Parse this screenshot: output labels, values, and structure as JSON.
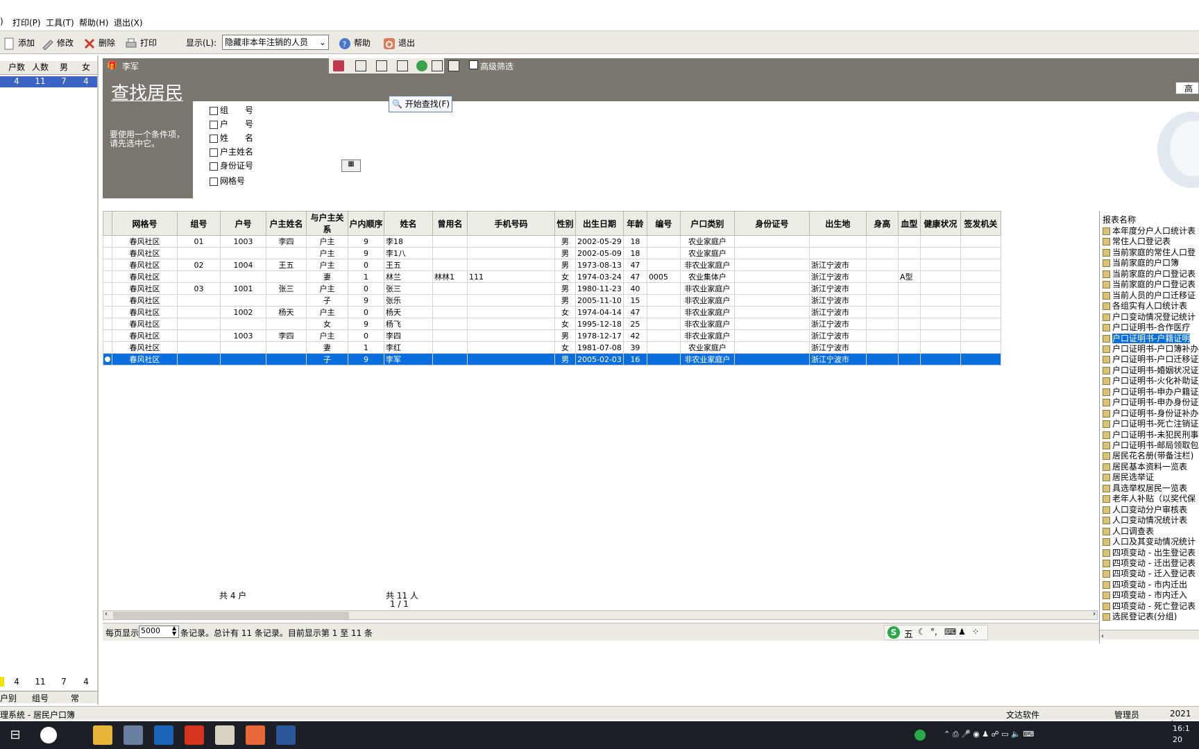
{
  "menu": {
    "items": [
      ")",
      "打印(P)",
      "工具(T)",
      "帮助(H)",
      "退出(X)"
    ]
  },
  "toolbar": {
    "add": "添加",
    "edit": "修改",
    "delete": "删除",
    "print": "打印",
    "display_label": "显示(L):",
    "display_value": "隐藏非本年注销的人员",
    "help": "帮助",
    "exit": "退出"
  },
  "left": {
    "headers": [
      "户数",
      "人数",
      "男",
      "女"
    ],
    "row": [
      "4",
      "11",
      "7",
      "4"
    ],
    "footer": [
      "4",
      "11",
      "7",
      "4"
    ],
    "tabs": [
      "户别",
      "组号",
      "常"
    ]
  },
  "subbar": {
    "name": "李军",
    "advanced_filter": "高级筛选"
  },
  "search": {
    "title": "查找居民",
    "hint": "要使用一个条件项，请先选中它。",
    "start_button": "开始查找(F)",
    "fields": [
      "组　　号",
      "户　　号",
      "姓　　名",
      "户主姓名",
      "身份证号",
      "网格号"
    ],
    "right_button": "高"
  },
  "grid": {
    "columns": [
      "网格号",
      "组号",
      "户号",
      "户主姓名",
      "与户主关系",
      "户内顺序",
      "姓名",
      "曾用名",
      "手机号码",
      "性别",
      "出生日期",
      "年龄",
      "编号",
      "户口类别",
      "身份证号",
      "出生地",
      "身高",
      "血型",
      "健康状况",
      "签发机关"
    ],
    "rows": [
      [
        "春风社区",
        "01",
        "1003",
        "李四",
        "户主",
        "9",
        "李18",
        "",
        "",
        "男",
        "2002-05-29",
        "18",
        "",
        "农业家庭户",
        "",
        "",
        "",
        "",
        "",
        ""
      ],
      [
        "春风社区",
        "",
        "",
        "",
        "户主",
        "9",
        "李1八",
        "",
        "",
        "男",
        "2002-05-09",
        "18",
        "",
        "农业家庭户",
        "",
        "",
        "",
        "",
        "",
        ""
      ],
      [
        "春风社区",
        "02",
        "1004",
        "王五",
        "户主",
        "0",
        "王五",
        "",
        "",
        "男",
        "1973-08-13",
        "47",
        "",
        "非农业家庭户",
        "",
        "浙江宁波市",
        "",
        "",
        "",
        ""
      ],
      [
        "春风社区",
        "",
        "",
        "",
        "妻",
        "1",
        "林兰",
        "林林1",
        "111",
        "女",
        "1974-03-24",
        "47",
        "0005",
        "农业集体户",
        "",
        "浙江宁波市",
        "",
        "A型",
        "",
        ""
      ],
      [
        "春风社区",
        "03",
        "1001",
        "张三",
        "户主",
        "0",
        "张三",
        "",
        "",
        "男",
        "1980-11-23",
        "40",
        "",
        "非农业家庭户",
        "",
        "浙江宁波市",
        "",
        "",
        "",
        ""
      ],
      [
        "春风社区",
        "",
        "",
        "",
        "子",
        "9",
        "张乐",
        "",
        "",
        "男",
        "2005-11-10",
        "15",
        "",
        "非农业家庭户",
        "",
        "浙江宁波市",
        "",
        "",
        "",
        ""
      ],
      [
        "春风社区",
        "",
        "1002",
        "杨天",
        "户主",
        "0",
        "杨天",
        "",
        "",
        "女",
        "1974-04-14",
        "47",
        "",
        "非农业家庭户",
        "",
        "浙江宁波市",
        "",
        "",
        "",
        ""
      ],
      [
        "春风社区",
        "",
        "",
        "",
        "女",
        "9",
        "杨飞",
        "",
        "",
        "女",
        "1995-12-18",
        "25",
        "",
        "非农业家庭户",
        "",
        "浙江宁波市",
        "",
        "",
        "",
        ""
      ],
      [
        "春风社区",
        "",
        "1003",
        "李四",
        "户主",
        "0",
        "李四",
        "",
        "",
        "男",
        "1978-12-17",
        "42",
        "",
        "非农业家庭户",
        "",
        "浙江宁波市",
        "",
        "",
        "",
        ""
      ],
      [
        "春风社区",
        "",
        "",
        "",
        "妻",
        "1",
        "李红",
        "",
        "",
        "女",
        "1981-07-08",
        "39",
        "",
        "农业家庭户",
        "",
        "浙江宁波市",
        "",
        "",
        "",
        ""
      ],
      [
        "春风社区",
        "",
        "",
        "",
        "子",
        "9",
        "李军",
        "",
        "",
        "男",
        "2005-02-03",
        "16",
        "",
        "非农业家庭户",
        "",
        "浙江宁波市",
        "",
        "",
        "",
        ""
      ]
    ],
    "selected_row": 10
  },
  "summary": {
    "households": "共 4 户",
    "persons": "共 11 人",
    "page": "1 / 1"
  },
  "pager": {
    "per_page_label": "每页显示",
    "per_page_value": "5000",
    "info": "条记录。总计有 11 条记录。目前显示第 1 至 11 条"
  },
  "reports": {
    "header": "报表名称",
    "items": [
      "本年度分户人口统计表",
      "常住人口登记表",
      "当前家庭的常住人口登",
      "当前家庭的户口簿",
      "当前家庭的户口登记表",
      "当前家庭的户口登记表",
      "当前人员的户口迁移证",
      "各组实有人口统计表",
      "户口变动情况登记统计",
      "户口证明书-合作医疗",
      "户口证明书-户籍证明",
      "户口证明书-户口簿补办",
      "户口证明书-户口迁移证",
      "户口证明书-婚姻状况证",
      "户口证明书-火化补助证",
      "户口证明书-申办户籍证",
      "户口证明书-申办身份证",
      "户口证明书-身份证补办",
      "户口证明书-死亡注销证",
      "户口证明书-未犯民刑事",
      "户口证明书-邮局领取包",
      "居民花名册(带备注栏)",
      "居民基本资料一览表",
      "居民选举证",
      "具选举权居民一览表",
      "老年人补贴（以奖代保",
      "人口变动分户审核表",
      "人口变动情况统计表",
      "人口调查表",
      "人口及其变动情况统计",
      "四项变动 - 出生登记表",
      "四项变动 - 迁出登记表",
      "四项变动 - 迁入登记表",
      "四项变动 - 市内迁出",
      "四项变动 - 市内迁入",
      "四项变动 - 死亡登记表",
      "选民登记表(分组)"
    ],
    "selected": 10
  },
  "ime": {
    "label": "五"
  },
  "status": {
    "left": "理系统 - 居民户口簿",
    "company": "文达软件",
    "user": "管理员",
    "date": "2021年"
  },
  "clock": {
    "time": "16:1",
    "date": "20"
  },
  "colors": {
    "selection": "#0a6edc",
    "header_bar": "#7a766d",
    "toolbar": "#eceae3",
    "taskbar": "#1c1f26"
  }
}
